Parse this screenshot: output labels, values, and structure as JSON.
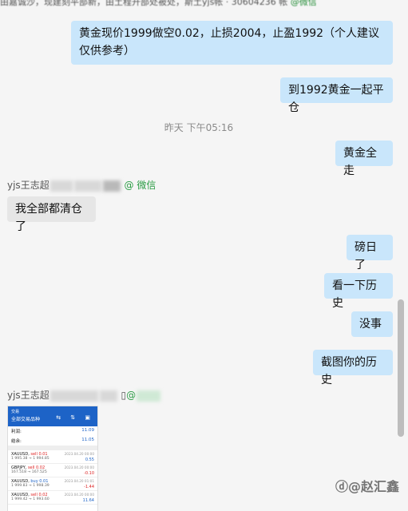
{
  "top_bar": {
    "text": "由嘉诚沙，现建刻平部新，由土程开部处被处，斯土yjs帐 · 30604236 帐",
    "tail": "@微信"
  },
  "messages": {
    "m1": "黄金现价1999做空0.02，止损2004，止盈1992（个人建议 仅供参考）",
    "m2": "到1992黄金一起平仓",
    "timestamp": "昨天 下午05:16",
    "m3": "黄金全走",
    "sender1_name": "yjs王志超",
    "sender1_at": "@ 微信",
    "m4": "我全部都清仓了",
    "m5": "磅日了",
    "m6": "看一下历史",
    "m7": "没事",
    "m8": "截图你的历史",
    "sender2_name": "yjs王志超",
    "sender2_at": "@"
  },
  "phone_screenshot": {
    "status": "交易",
    "title": "全部交易品种",
    "icons": "⇆ ⇅ ▣",
    "profit_label": "利润:",
    "profit_value": "11.09",
    "deposit_label": "结余:",
    "deposit_value": "11.05",
    "trades": [
      {
        "symbol": "XAUUSD,",
        "side": "sell",
        "lots": "0.01",
        "prices": "1 995.38 → 1 994.85",
        "time": "2023.04.20 00:00",
        "pl": "0.55",
        "pl_sign": "pos"
      },
      {
        "symbol": "GBPJPY,",
        "side": "sell",
        "lots": "0.02",
        "prices": "167.518 → 167.525",
        "time": "2023.04.20 00:00",
        "pl": "-0.10",
        "pl_sign": "neg"
      },
      {
        "symbol": "XAUUSD,",
        "side": "buy",
        "lots": "0.01",
        "prices": "1 999.83 → 1 998.39",
        "time": "2023.04.20 01:01",
        "pl": "-1.44",
        "pl_sign": "neg"
      },
      {
        "symbol": "XAUUSD,",
        "side": "sell",
        "lots": "0.02",
        "prices": "1 999.42 → 1 993.60",
        "time": "2023.04.20 00:00",
        "pl": "11.64",
        "pl_sign": "pos"
      }
    ]
  },
  "watermark": "ⓓ@赵汇鑫",
  "colors": {
    "outgoing_bubble": "#c9e6fb",
    "incoming_bubble": "#e6e6e6",
    "background": "#f5f5f5",
    "wechat_green": "#2a9c44",
    "app_blue": "#1d63c7"
  }
}
